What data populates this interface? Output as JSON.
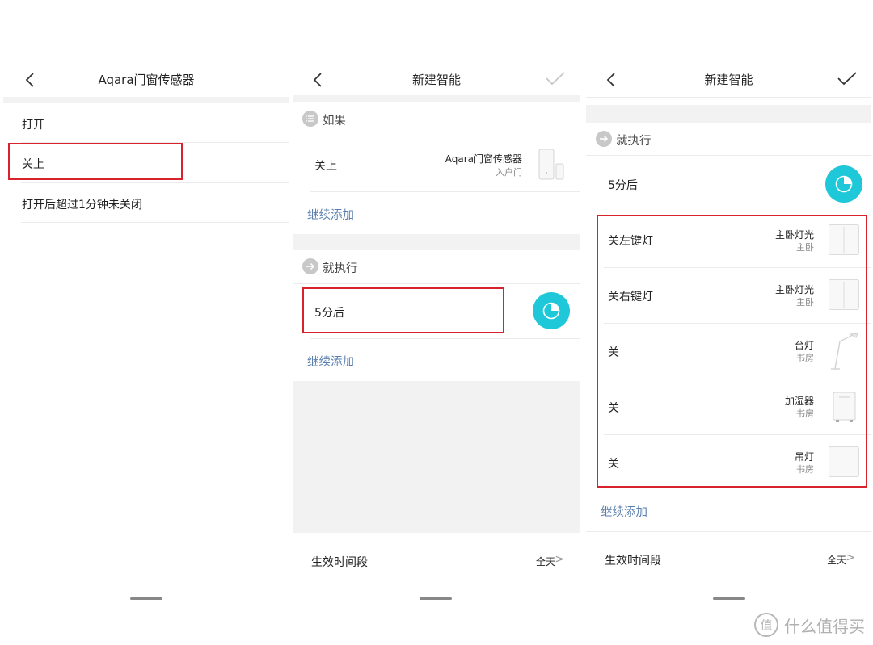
{
  "panel1": {
    "title": "Aqara门窗传感器",
    "options": [
      "打开",
      "关上",
      "打开后超过1分钟未关闭"
    ]
  },
  "panel2": {
    "title": "新建智能",
    "if_header": "如果",
    "if_action": "关上",
    "if_device_name": "Aqara门窗传感器",
    "if_device_room": "入户门",
    "add_more_1": "继续添加",
    "then_header": "就执行",
    "delay_label": "5分后",
    "add_more_2": "继续添加",
    "time_label": "生效时间段",
    "time_value": "全天",
    "time_chevron": ">"
  },
  "panel3": {
    "title": "新建智能",
    "then_header": "就执行",
    "delay_label": "5分后",
    "actions": [
      {
        "action": "关左键灯",
        "device": "主卧灯光",
        "room": "主卧",
        "icon": "wall-switch-icon"
      },
      {
        "action": "关右键灯",
        "device": "主卧灯光",
        "room": "主卧",
        "icon": "wall-switch-icon"
      },
      {
        "action": "关",
        "device": "台灯",
        "room": "书房",
        "icon": "desk-lamp-icon"
      },
      {
        "action": "关",
        "device": "加湿器",
        "room": "书房",
        "icon": "humidifier-icon"
      },
      {
        "action": "关",
        "device": "吊灯",
        "room": "书房",
        "icon": "wall-switch-icon"
      }
    ],
    "add_more": "继续添加",
    "time_label": "生效时间段",
    "time_value": "全天",
    "time_chevron": ">"
  },
  "watermark": {
    "text": "什么值得买",
    "logo_char": "值"
  },
  "colors": {
    "accent_teal": "#1ec8d8",
    "link_blue": "#5a7fae",
    "highlight_red": "#d9232c",
    "divider": "#ebebeb",
    "section_bg": "#f2f2f2"
  }
}
